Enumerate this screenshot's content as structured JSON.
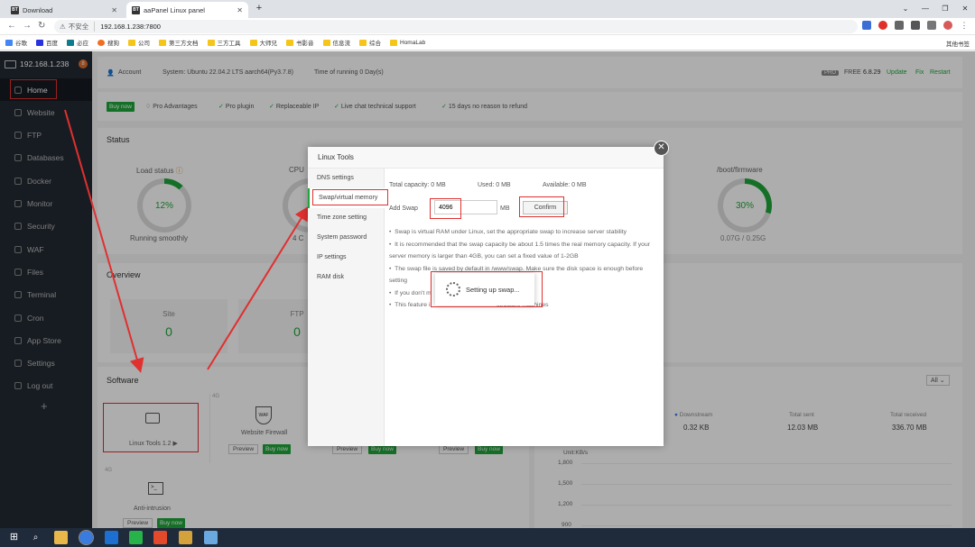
{
  "browser": {
    "tabs": [
      {
        "label": "Download",
        "favicon": "BT"
      },
      {
        "label": "aaPanel Linux panel",
        "favicon": "BT"
      }
    ],
    "address": {
      "security_label": "不安全",
      "url": "192.168.1.238:7800"
    },
    "bookmarks": [
      "谷歌",
      "百度",
      "必应",
      "搜狗",
      "公司",
      "第三方文档",
      "三方工具",
      "大师兄",
      "书影音",
      "信息流",
      "综合",
      "HomaLab"
    ],
    "other_bookmarks": "其他书签"
  },
  "sidebar": {
    "server_ip": "192.168.1.238",
    "badge": "8",
    "items": [
      {
        "label": "Home"
      },
      {
        "label": "Website"
      },
      {
        "label": "FTP"
      },
      {
        "label": "Databases"
      },
      {
        "label": "Docker"
      },
      {
        "label": "Monitor"
      },
      {
        "label": "Security"
      },
      {
        "label": "WAF"
      },
      {
        "label": "Files"
      },
      {
        "label": "Terminal"
      },
      {
        "label": "Cron"
      },
      {
        "label": "App Store"
      },
      {
        "label": "Settings"
      },
      {
        "label": "Log out"
      }
    ],
    "add": "+"
  },
  "header": {
    "account": "Account",
    "system": "System:  Ubuntu 22.04.2 LTS aarch64(Py3.7.8)",
    "uptime": "Time of running 0 Day(s)",
    "pro_badge": "PRO",
    "free_label": "FREE",
    "version": "6.8.29",
    "update": "Update",
    "fix": "Fix",
    "restart": "Restart"
  },
  "pro_bar": {
    "buy_now": "Buy now",
    "advantages": "Pro Advantages",
    "items": [
      "Pro plugin",
      "Replaceable IP",
      "Live chat technical support",
      "15 days no reason to refund"
    ]
  },
  "status": {
    "title": "Status",
    "load": {
      "label": "Load status",
      "value": "12%",
      "percent": 12,
      "caption": "Running smoothly"
    },
    "cpu": {
      "label": "CPU",
      "value": "2",
      "caption": "4 C"
    },
    "boot": {
      "label": "/boot/firmware",
      "value": "30%",
      "percent": 30,
      "caption": "0.07G / 0.25G"
    }
  },
  "overview": {
    "title": "Overview",
    "site": {
      "label": "Site",
      "value": "0"
    },
    "ftp": {
      "label": "FTP",
      "value": "0"
    }
  },
  "software": {
    "title": "Software",
    "filter": "All",
    "items": [
      {
        "name": "Linux Tools 1.2",
        "tag": ""
      },
      {
        "name": "Website Firewall",
        "tag": "4G",
        "preview": "Preview",
        "buy": "Buy now"
      },
      {
        "name": "",
        "tag": "",
        "preview": "Preview",
        "buy": "Buy now"
      },
      {
        "name": "",
        "tag": "",
        "preview": "Preview",
        "buy": "Buy now"
      },
      {
        "name": "Anti-intrusion",
        "tag": "4G",
        "preview": "Preview",
        "buy": "Buy now"
      }
    ]
  },
  "traffic": {
    "downstream_label": "Downstream",
    "downstream": "0.32 KB",
    "total_sent_label": "Total sent",
    "total_sent": "12.03 MB",
    "total_received_label": "Total received",
    "total_received": "336.70 MB",
    "unit": "Unit:KB/s",
    "ticks": [
      "1,800",
      "1,500",
      "1,200",
      "900"
    ]
  },
  "modal": {
    "title": "Linux Tools",
    "nav": [
      "DNS settings",
      "Swap/virtual memory",
      "Time zone setting",
      "System password",
      "IP settings",
      "RAM disk"
    ],
    "total_capacity": "Total capacity:  0 MB",
    "used": "Used:  0 MB",
    "available": "Available:  0 MB",
    "add_swap_label": "Add Swap",
    "swap_value": "4096",
    "unit": "MB",
    "confirm": "Confirm",
    "notes": [
      "Swap is virtual RAM under Linux, set the appropriate swap to increase server stability",
      "It is recommended that the swap capacity be about 1.5 times the real memory capacity. If your server memory is larger than 4GB, you can set a fixed value of 1-2GB",
      "The swap file is saved by default in /www/swap. Make sure the disk space is enough before setting",
      "If you don't m",
      "This feature i                                       structure machines"
    ]
  },
  "loading": {
    "text": "Setting up swap..."
  },
  "colors": {
    "accent": "#20a53a",
    "annotation": "#e03030",
    "sidebar_bg": "#222a33"
  }
}
